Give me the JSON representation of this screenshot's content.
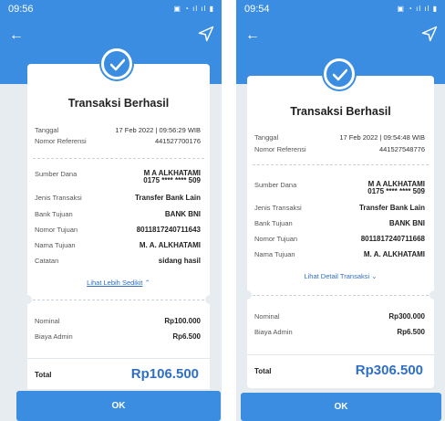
{
  "left": {
    "status_time": "09:56",
    "title": "Transaksi Berhasil",
    "tanggal_label": "Tanggal",
    "tanggal_value": "17 Feb 2022 | 09:56:29 WIB",
    "ref_label": "Nomor Referensi",
    "ref_value": "441527700176",
    "sumber_label": "Sumber Dana",
    "sumber_name": "M A ALKHATAMI",
    "sumber_account": "0175 **** **** 509",
    "jenis_label": "Jenis Transaksi",
    "jenis_value": "Transfer Bank Lain",
    "bank_label": "Bank Tujuan",
    "bank_value": "BANK BNI",
    "nomor_tujuan_label": "Nomor Tujuan",
    "nomor_tujuan_value": "8011817240711643",
    "nama_label": "Nama Tujuan",
    "nama_value": "M. A. ALKHATAMI",
    "catatan_label": "Catatan",
    "catatan_value": "sidang hasil",
    "toggle_link": "Lihat Lebih Sedikit",
    "nominal_label": "Nominal",
    "nominal_value": "Rp100.000",
    "admin_label": "Biaya Admin",
    "admin_value": "Rp6.500",
    "total_label": "Total",
    "total_value": "Rp106.500",
    "ok_label": "OK"
  },
  "right": {
    "status_time": "09:54",
    "title": "Transaksi Berhasil",
    "tanggal_label": "Tanggal",
    "tanggal_value": "17 Feb 2022 | 09:54:48 WIB",
    "ref_label": "Nomor Referensi",
    "ref_value": "441527548776",
    "sumber_label": "Sumber Dana",
    "sumber_name": "M A ALKHATAMI",
    "sumber_account": "0175 **** **** 509",
    "jenis_label": "Jenis Transaksi",
    "jenis_value": "Transfer Bank Lain",
    "bank_label": "Bank Tujuan",
    "bank_value": "BANK BNI",
    "nomor_tujuan_label": "Nomor Tujuan",
    "nomor_tujuan_value": "8011817240711668",
    "nama_label": "Nama Tujuan",
    "nama_value": "M. A. ALKHATAMI",
    "toggle_link": "Lihat Detail Transaksi",
    "nominal_label": "Nominal",
    "nominal_value": "Rp300.000",
    "admin_label": "Biaya Admin",
    "admin_value": "Rp6.500",
    "total_label": "Total",
    "total_value": "Rp306.500",
    "ok_label": "OK"
  },
  "icons": {
    "back": "arrow-left-icon",
    "share": "send-icon",
    "success": "check-icon",
    "collapse": "chevron-up-icon",
    "expand": "chevron-down-icon"
  },
  "colors": {
    "primary": "#3a8de0",
    "link": "#2f6fc6",
    "page": "#e7ecf1"
  }
}
